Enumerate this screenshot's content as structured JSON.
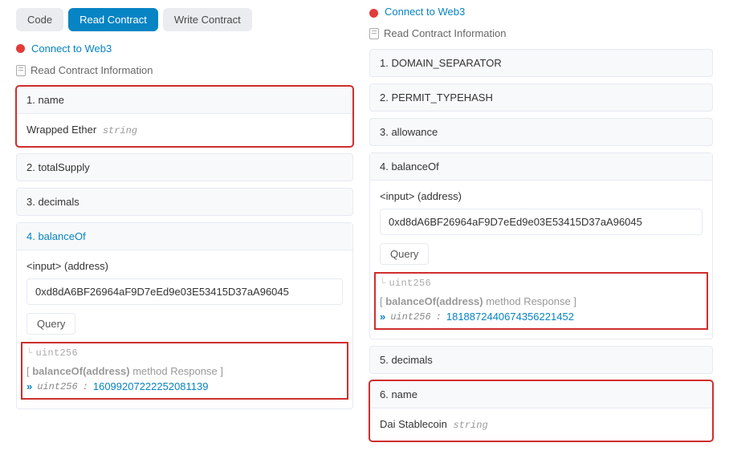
{
  "left": {
    "tabs": {
      "code": "Code",
      "read": "Read Contract",
      "write": "Write Contract"
    },
    "connect": "Connect to Web3",
    "read_info": "Read Contract Information",
    "name": {
      "header": "1. name",
      "value": "Wrapped Ether",
      "type": "string"
    },
    "totalSupply": "2. totalSupply",
    "decimals": "3. decimals",
    "balanceOf": {
      "header": "4. balanceOf",
      "input_label": "<input> (address)",
      "input_value": "0xd8dA6BF26964aF9D7eEd9e03E53415D37aA96045",
      "query": "Query",
      "return_type": "uint256",
      "response_prefix": "[ ",
      "response_method": "balanceOf(address)",
      "response_suffix": " method Response ]",
      "result_type": "uint256",
      "result_sep": " :  ",
      "result_value": "16099207222252081139"
    }
  },
  "right": {
    "connect": "Connect to Web3",
    "read_info": "Read Contract Information",
    "domain_separator": "1. DOMAIN_SEPARATOR",
    "permit_typehash": "2. PERMIT_TYPEHASH",
    "allowance": "3. allowance",
    "balanceOf": {
      "header": "4. balanceOf",
      "input_label": "<input> (address)",
      "input_value": "0xd8dA6BF26964aF9D7eEd9e03E53415D37aA96045",
      "query": "Query",
      "return_type": "uint256",
      "response_prefix": "[ ",
      "response_method": "balanceOf(address)",
      "response_suffix": " method Response ]",
      "result_type": "uint256",
      "result_sep": " :  ",
      "result_value": "1818872440674356221452"
    },
    "decimals": "5. decimals",
    "name": {
      "header": "6. name",
      "value": "Dai Stablecoin",
      "type": "string"
    }
  }
}
